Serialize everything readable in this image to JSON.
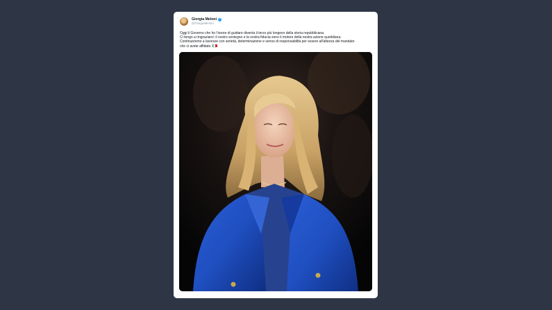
{
  "tweet": {
    "author": {
      "display_name": "Giorgia Meloni",
      "handle": "@GiorgiaMeloni",
      "verified": true
    },
    "text_lines": [
      "Oggi il Governo che ho l'onore di guidare diventa il terzo più longevo della storia repubblicana.",
      "Ci tengo a ringraziarvi: il vostro sostegno e la vostra fiducia sono il motore della nostra azione quotidiana.",
      "Continueremo a lavorare con serietà, determinazione e senso di responsabilità per essere all'altezza del mandato",
      "che ci avete affidato"
    ],
    "emoji_flag": "italy-flag-icon",
    "media": {
      "type": "photo"
    }
  },
  "colors": {
    "page_background": "#2e3544",
    "card_background": "#ffffff",
    "verified_badge": "#1d9bf0",
    "jacket_blue": "#1f4fc0"
  }
}
